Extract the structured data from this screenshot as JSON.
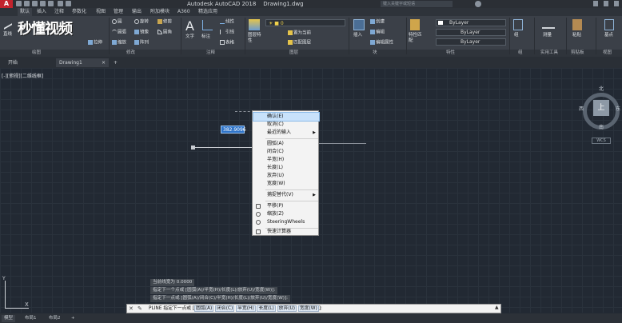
{
  "window": {
    "title": "Autodesk AutoCAD 2018",
    "document": "Drawing1.dwg",
    "app_logo": "A",
    "search_placeholder": "键入关键字或短语"
  },
  "watermark": "秒懂视频",
  "menu_tabs": [
    "默认",
    "插入",
    "注释",
    "参数化",
    "视图",
    "管理",
    "输出",
    "附加模块",
    "A360",
    "精选应用"
  ],
  "ribbon": {
    "draw": {
      "label": "绘图",
      "big_button": "直线",
      "items": [
        "圆",
        "圆弧",
        "矩形"
      ]
    },
    "modify": {
      "label": "修改",
      "items": [
        "移动",
        "旋转",
        "修剪",
        "复制",
        "镜像",
        "圆角",
        "拉伸",
        "缩放",
        "阵列"
      ]
    },
    "annotation": {
      "label": "注释",
      "big_buttons": [
        "文字",
        "标注"
      ],
      "items": [
        "线性",
        "引线",
        "表格"
      ]
    },
    "layers": {
      "label": "图层",
      "big_button": "图层特性",
      "items": [
        "置为当前",
        "匹配图层"
      ]
    },
    "block": {
      "label": "块",
      "big_button": "插入",
      "items": [
        "创建",
        "编辑",
        "编辑属性"
      ]
    },
    "properties": {
      "label": "特性",
      "big_button": "特性匹配",
      "bylayer": [
        "ByLayer",
        "ByLayer",
        "ByLayer"
      ]
    },
    "groups": {
      "label": "组",
      "big_button": "组"
    },
    "utilities": {
      "label": "实用工具",
      "big_button": "测量"
    },
    "clipboard": {
      "label": "剪贴板",
      "big_button": "粘贴"
    },
    "view": {
      "label": "视图",
      "big_button": "基点"
    }
  },
  "file_tabs": [
    "开始",
    "Drawing1"
  ],
  "viewport_label": "[-][俯视][二维线框]",
  "viewcube": {
    "face": "上",
    "north": "北",
    "south": "南",
    "west": "西",
    "east": "东",
    "wcs": "WCS"
  },
  "dynamic_input_value": "382.9096",
  "context_menu": {
    "group1": [
      "确认(E)",
      "取消(C)",
      "最近的输入"
    ],
    "group2": [
      "圆弧(A)",
      "闭合(C)",
      "半宽(H)",
      "长度(L)",
      "放弃(U)",
      "宽度(W)"
    ],
    "group3": [
      "捕捉替代(V)"
    ],
    "group4": [
      "平移(P)",
      "缩放(Z)",
      "SteeringWheels"
    ],
    "group5": [
      "快速计算器"
    ]
  },
  "command_history": [
    "当前线宽为 0.0000",
    "指定下一个点或 [圆弧(A)/半宽(H)/长度(L)/放弃(U)/宽度(W)]:",
    "指定下一点或 [圆弧(A)/闭合(C)/半宽(H)/长度(L)/放弃(U)/宽度(W)]:"
  ],
  "command_line": {
    "prefix": "PLINE 指定下一点或 [",
    "options": [
      "圆弧(A)",
      "闭合(C)",
      "半宽(H)",
      "长度(L)",
      "放弃(U)",
      "宽度(W)"
    ],
    "suffix": "]:"
  },
  "layout_tabs": [
    "模型",
    "布局1",
    "布局2"
  ],
  "colors": {
    "accent": "#2f74c9",
    "menu_highlight": "#c8e2fb",
    "canvas": "#222933"
  }
}
